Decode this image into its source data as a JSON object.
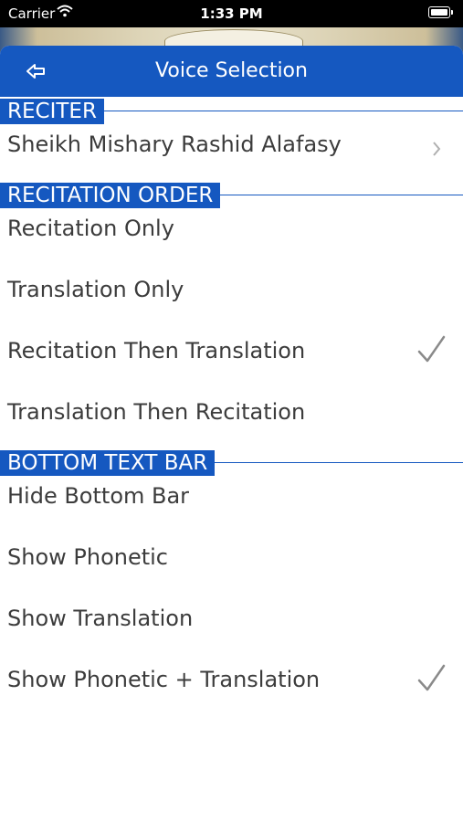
{
  "status_bar": {
    "carrier": "Carrier",
    "time": "1:33 PM"
  },
  "navbar": {
    "title": "Voice Selection"
  },
  "sections": {
    "reciter": {
      "header": "RECITER",
      "items": [
        {
          "label": "Sheikh Mishary Rashid Alafasy"
        }
      ]
    },
    "order": {
      "header": "RECITATION ORDER",
      "items": [
        {
          "label": "Recitation Only",
          "selected": false
        },
        {
          "label": "Translation Only",
          "selected": false
        },
        {
          "label": "Recitation Then Translation",
          "selected": true
        },
        {
          "label": "Translation Then Recitation",
          "selected": false
        }
      ]
    },
    "bottom_bar": {
      "header": "BOTTOM TEXT BAR",
      "items": [
        {
          "label": "Hide Bottom Bar",
          "selected": false
        },
        {
          "label": "Show Phonetic",
          "selected": false
        },
        {
          "label": "Show Translation",
          "selected": false
        },
        {
          "label": "Show Phonetic + Translation",
          "selected": true
        }
      ]
    }
  },
  "colors": {
    "accent": "#1558c0",
    "row_text": "#3c3c3c",
    "check": "#8a8a8a"
  },
  "icons": {
    "back": "back-arrow-icon",
    "chevron": "chevron-right-icon",
    "check": "checkmark-icon"
  }
}
